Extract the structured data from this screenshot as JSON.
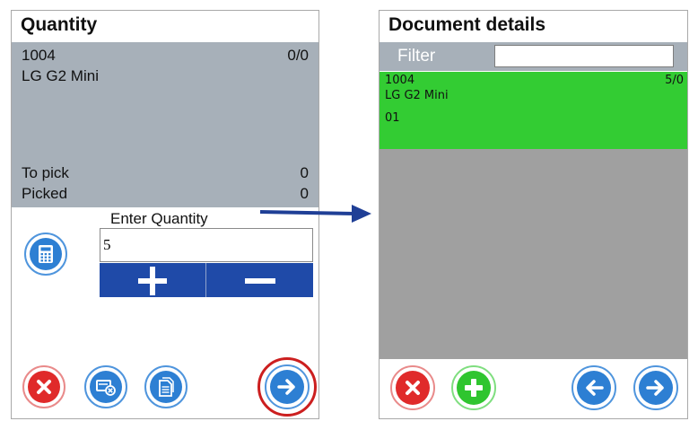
{
  "quantity_screen": {
    "title": "Quantity",
    "item_code": "1004",
    "item_count": "0/0",
    "item_name": "LG G2 Mini",
    "to_pick_label": "To pick",
    "to_pick_value": "0",
    "picked_label": "Picked",
    "picked_value": "0",
    "enter_quantity_label": "Enter Quantity",
    "quantity_value": "5",
    "buttons": [
      "calculator-icon",
      "cancel-icon",
      "clear-icon",
      "document-icon",
      "next-arrow-icon",
      "plus-icon",
      "minus-icon"
    ]
  },
  "document_details_screen": {
    "title": "Document details",
    "filter_label": "Filter",
    "filter_value": "",
    "row": {
      "code": "1004",
      "count": "5/0",
      "name": "LG G2 Mini",
      "line": "01"
    },
    "buttons": [
      "cancel-icon",
      "add-icon",
      "back-arrow-icon",
      "next-arrow-icon"
    ]
  },
  "colors": {
    "header_gray": "#a7b0b9",
    "stepper_blue": "#1f4aa8",
    "row_green": "#33cc33",
    "body_gray": "#a0a0a0",
    "cancel_red": "#e02a2a",
    "action_blue": "#2d7fd3",
    "add_green": "#2fc52f",
    "highlight_red": "#cc1f1f"
  }
}
